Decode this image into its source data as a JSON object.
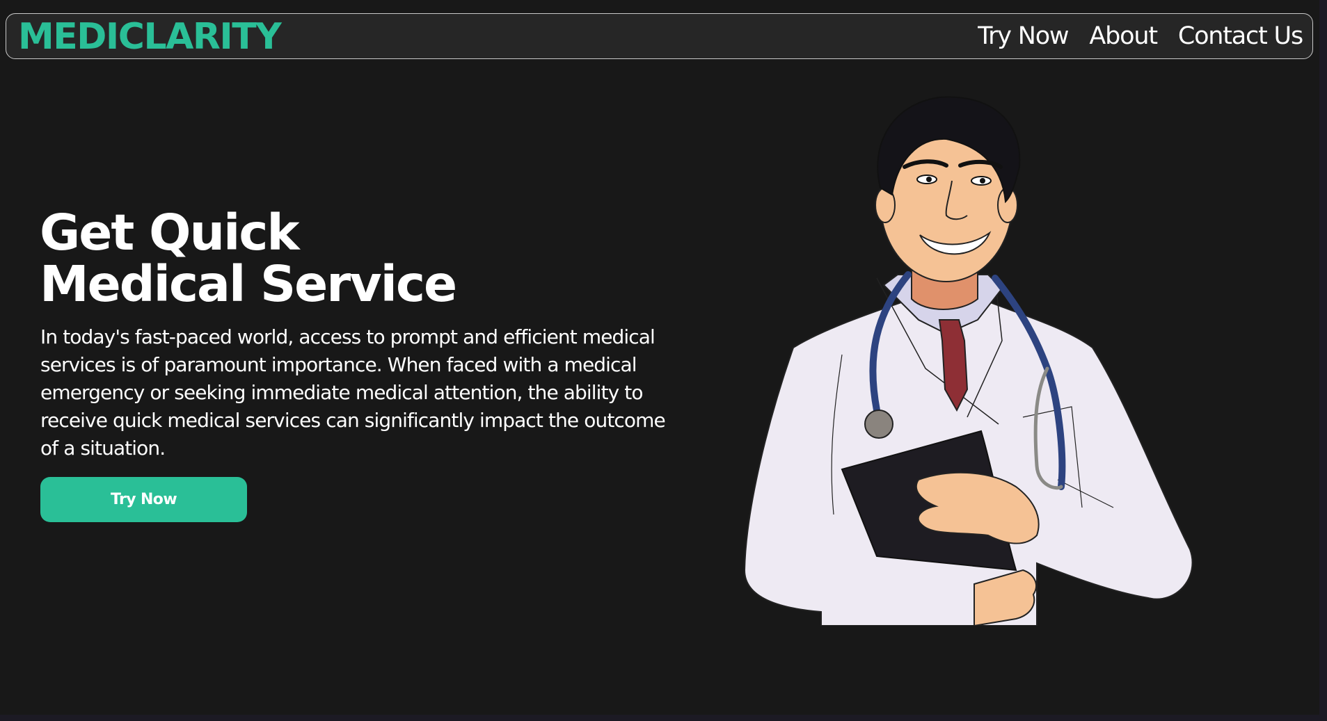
{
  "brand": {
    "name": "MEDICLARITY",
    "color": "#2abf97"
  },
  "nav": {
    "items": [
      {
        "label": "Try Now"
      },
      {
        "label": "About"
      },
      {
        "label": "Contact Us"
      }
    ]
  },
  "hero": {
    "title_line1": "Get Quick",
    "title_line2": "Medical Service",
    "description": "In today's fast-paced world, access to prompt and efficient medical services is of paramount importance. When faced with a medical emergency or seeking immediate medical attention, the ability to receive quick medical services can significantly impact the outcome of a situation.",
    "cta_label": "Try Now"
  },
  "colors": {
    "background": "#181818",
    "navbar": "#262626",
    "accent": "#2abf97",
    "text": "#ffffff"
  }
}
